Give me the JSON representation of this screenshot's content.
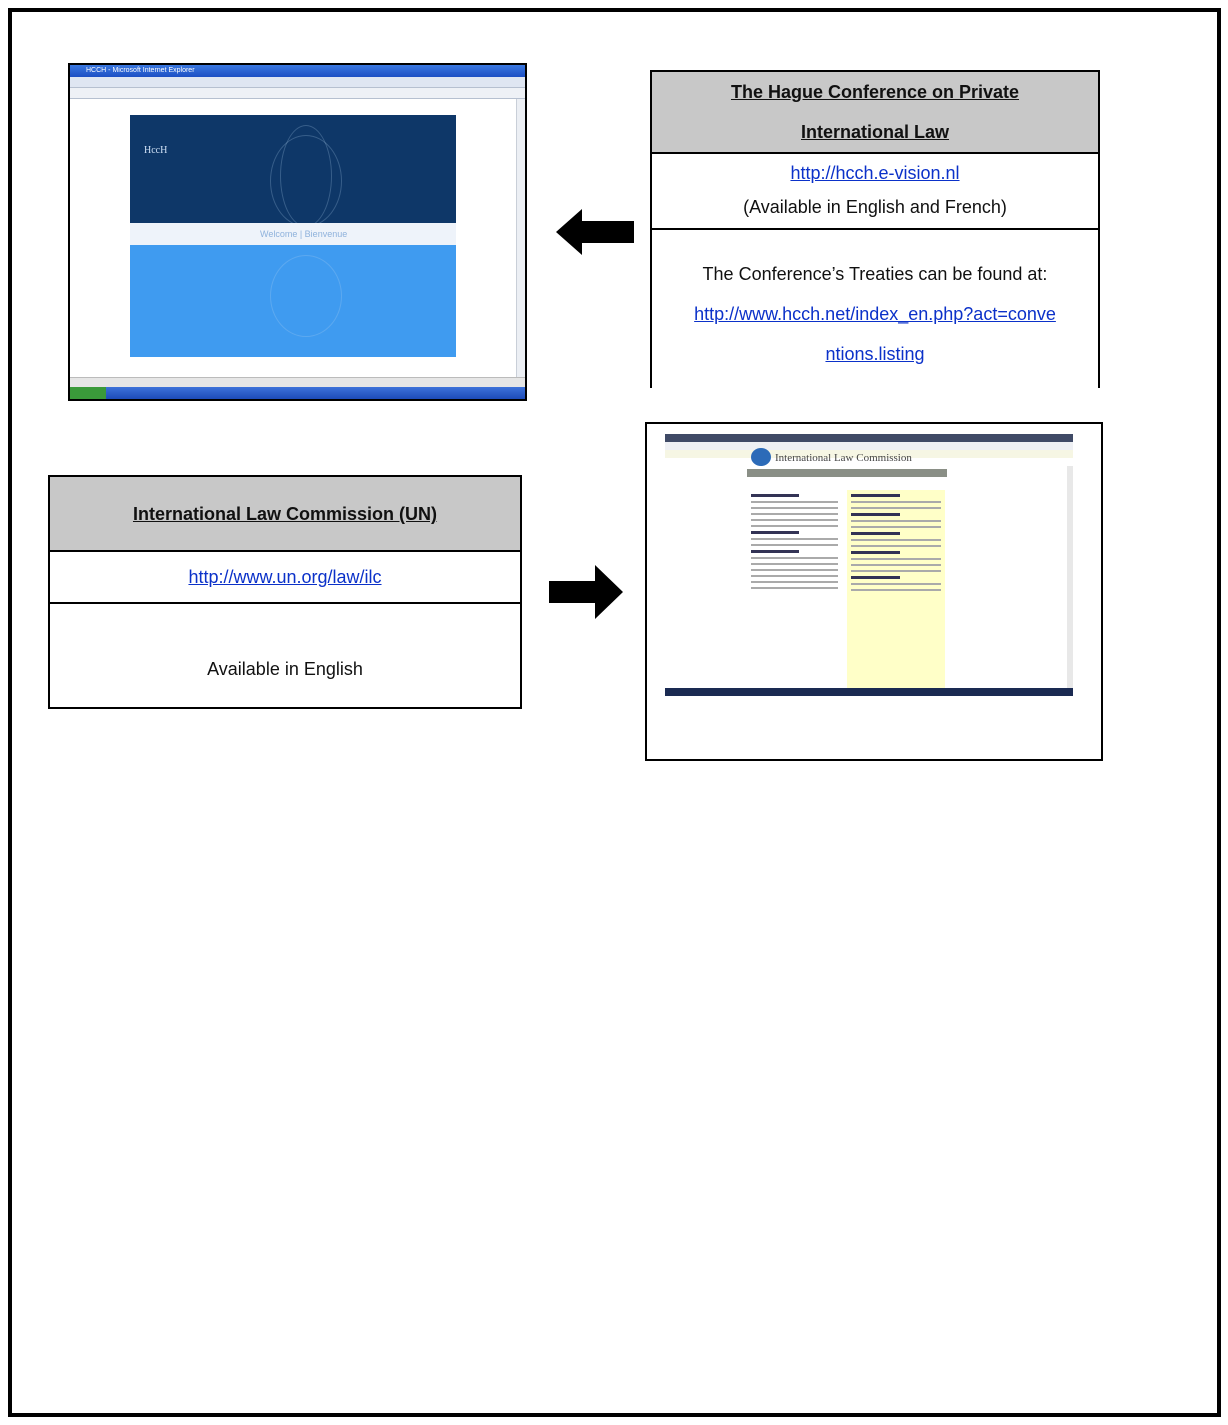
{
  "hague": {
    "title_line1": "The Hague Conference on Private",
    "title_line2": "International Law",
    "link": "http://hcch.e-vision.nl",
    "availability": "(Available in English and French)",
    "treaties_text": "The Conference’s Treaties can be found at:",
    "treaties_link_line1": "http://www.hcch.net/index_en.php?act=conve",
    "treaties_link_line2": "ntions.listing"
  },
  "ilc": {
    "title": "International Law Commission (UN)",
    "link": "http://www.un.org/law/ilc",
    "availability": "Available in English"
  },
  "screenshots": {
    "hcch_site": {
      "window_title": "HCCH - Microsoft Internet Explorer",
      "logo": "HccH",
      "welcome_text": "Welcome | Bienvenue"
    },
    "ilc_site": {
      "header": "International Law Commission"
    }
  },
  "colors": {
    "header_fill": "#c8c8c8",
    "link": "#0b31c9",
    "hcch_dark": "#0e3768",
    "hcch_light": "#3f9bf0",
    "ilc_sidebar": "#ffffc8"
  },
  "icons": [
    "arrow-left-icon",
    "arrow-right-icon",
    "un-emblem-icon"
  ]
}
